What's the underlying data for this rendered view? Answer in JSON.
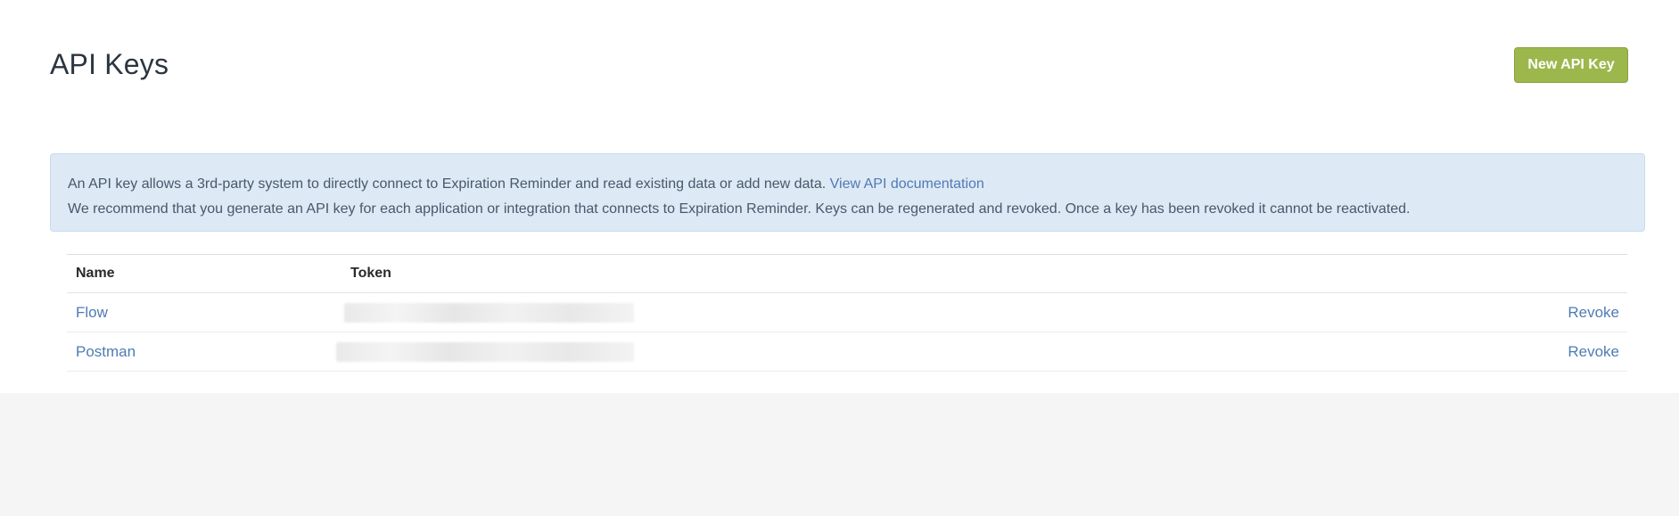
{
  "header": {
    "title": "API Keys",
    "new_button_label": "New API Key"
  },
  "info": {
    "line1_text": "An API key allows a 3rd-party system to directly connect to Expiration Reminder and read existing data or add new data.",
    "line1_link": "View API documentation",
    "line2_text": "We recommend that you generate an API key for each application or integration that connects to Expiration Reminder. Keys can be regenerated and revoked. Once a key has been revoked it cannot be reactivated."
  },
  "table": {
    "columns": [
      "Name",
      "Token"
    ],
    "rows": [
      {
        "name": "Flow",
        "action": "Revoke"
      },
      {
        "name": "Postman",
        "action": "Revoke"
      }
    ]
  },
  "colors": {
    "primary_button": "#9cb84c",
    "link": "#4f7bb5",
    "info_background": "#dde9f5"
  }
}
